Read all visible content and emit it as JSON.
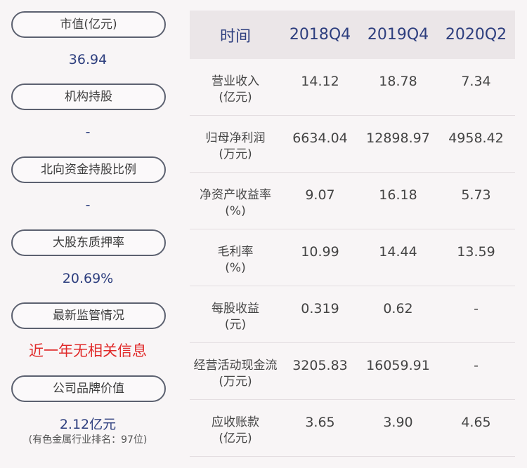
{
  "left": {
    "items": [
      {
        "label": "市值(亿元)",
        "value": "36.94"
      },
      {
        "label": "机构持股",
        "value": "-"
      },
      {
        "label": "北向资金持股比例",
        "value": "-"
      },
      {
        "label": "大股东质押率",
        "value": "20.69%"
      },
      {
        "label": "最新监管情况",
        "value": "近一年无相关信息"
      },
      {
        "label": "公司品牌价值",
        "value": "2.12亿元",
        "note": "(有色金属行业排名：97位)"
      }
    ]
  },
  "table": {
    "headers": [
      "时间",
      "2018Q4",
      "2019Q4",
      "2020Q2"
    ],
    "rows": [
      {
        "label1": "营业收入",
        "label2": "(亿元)",
        "values": [
          "14.12",
          "18.78",
          "7.34"
        ]
      },
      {
        "label1": "归母净利润",
        "label2": "(万元)",
        "values": [
          "6634.04",
          "12898.97",
          "4958.42"
        ]
      },
      {
        "label1": "净资产收益率",
        "label2": "(%)",
        "values": [
          "9.07",
          "16.18",
          "5.73"
        ]
      },
      {
        "label1": "毛利率",
        "label2": "(%)",
        "values": [
          "10.99",
          "14.44",
          "13.59"
        ]
      },
      {
        "label1": "每股收益",
        "label2": "(元)",
        "values": [
          "0.319",
          "0.62",
          "-"
        ]
      },
      {
        "label1": "经营活动现金流",
        "label2": "(万元)",
        "values": [
          "3205.83",
          "16059.91",
          "-"
        ]
      },
      {
        "label1": "应收账款",
        "label2": "(亿元)",
        "values": [
          "3.65",
          "3.90",
          "4.65"
        ]
      }
    ]
  }
}
